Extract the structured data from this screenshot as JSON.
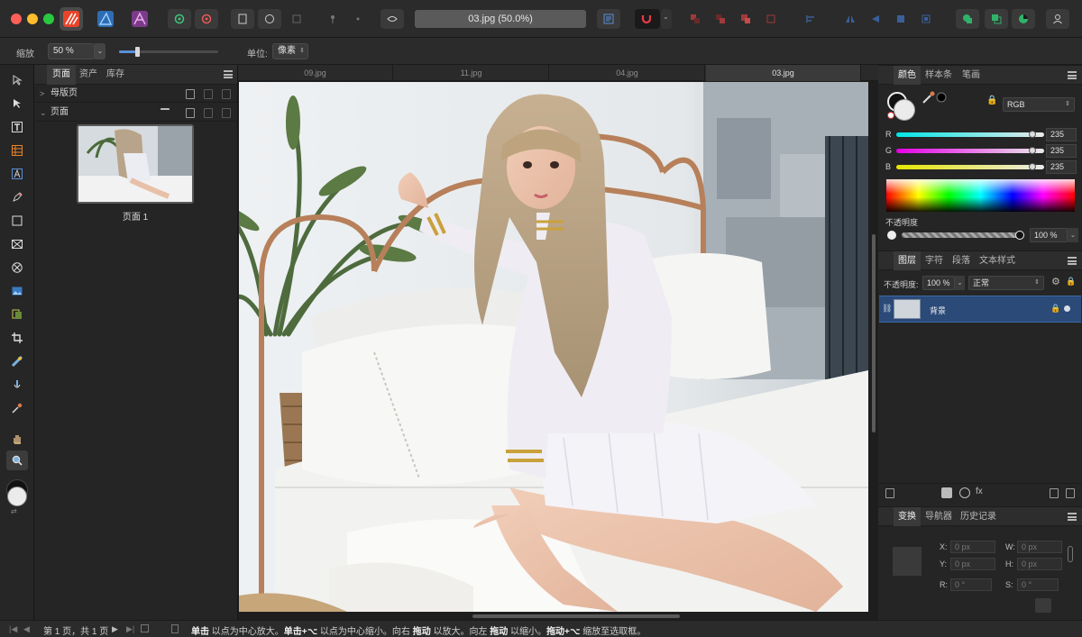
{
  "window": {
    "title": "03.jpg (50.0%)"
  },
  "context_bar": {
    "zoom_label": "缩放",
    "zoom_value": "50 %",
    "zoom_fraction": 0.18,
    "unit_label": "单位:",
    "unit_value": "像素"
  },
  "pages_panel": {
    "tabs": [
      "页面",
      "资产",
      "库存"
    ],
    "master_pages_label": "母版页",
    "pages_label": "页面",
    "page_thumb_label": "页面 1"
  },
  "doc_tabs": [
    "09.jpg",
    "11.jpg",
    "04.jpg",
    "03.jpg"
  ],
  "color_panel": {
    "tabs": [
      "颜色",
      "样本条",
      "笔画"
    ],
    "mode": "RGB",
    "channels": [
      {
        "label": "R",
        "value": "235",
        "fraction": 0.92,
        "gradient": "linear-gradient(to right, #00e5e5, #eaeaea)"
      },
      {
        "label": "G",
        "value": "235",
        "fraction": 0.92,
        "gradient": "linear-gradient(to right, #e500e5, #eaeaea)"
      },
      {
        "label": "B",
        "value": "235",
        "fraction": 0.92,
        "gradient": "linear-gradient(to right, #e5e500, #eaeaea)"
      }
    ],
    "opacity_label": "不透明度",
    "opacity_value": "100 %"
  },
  "layers_panel": {
    "tabs": [
      "图层",
      "字符",
      "段落",
      "文本样式"
    ],
    "opacity_label": "不透明度:",
    "opacity_value": "100 %",
    "blend_mode": "正常",
    "layer_name": "背景"
  },
  "transform_panel": {
    "tabs": [
      "变换",
      "导航器",
      "历史记录"
    ],
    "x_label": "X:",
    "x_value": "0 px",
    "y_label": "Y:",
    "y_value": "0 px",
    "w_label": "W:",
    "w_value": "0 px",
    "h_label": "H:",
    "h_value": "0 px",
    "r_label": "R:",
    "r_value": "0 °",
    "s_label": "S:",
    "s_value": "0 °"
  },
  "status_bar": {
    "page_info": "第 1 页，共 1 页",
    "hint_1_bold": "单击",
    "hint_1": " 以点为中心放大。",
    "hint_2_bold": "单击+⌥",
    "hint_2": " 以点为中心缩小。向右 ",
    "hint_3_bold": "拖动",
    "hint_3": " 以放大。向左 ",
    "hint_4_bold": "拖动",
    "hint_4": " 以缩小。",
    "hint_5_bold": "拖动+⌥",
    "hint_5": " 缩放至选取框。"
  },
  "colors": {
    "accent": "#5a8fd6",
    "layer_selected": "#2b4a78",
    "persona_photo": "#e8442a",
    "persona_designer": "#2e6db4",
    "persona_publisher": "#7c3a8a"
  }
}
